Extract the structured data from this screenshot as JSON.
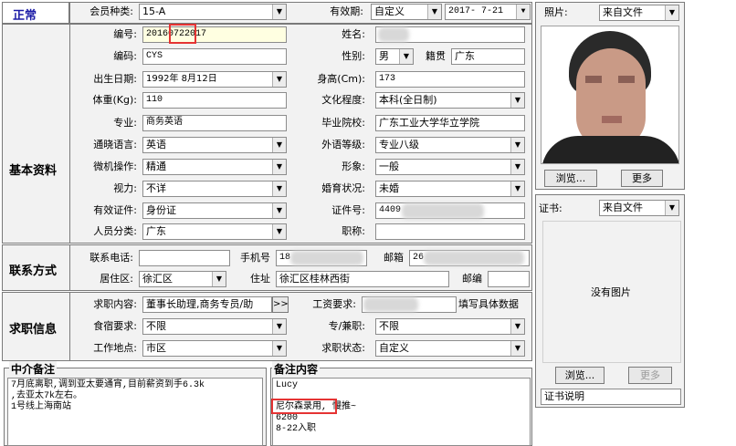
{
  "status_label": "正常",
  "section_basic": "基本资料",
  "section_contact": "联系方式",
  "section_job": "求职信息",
  "fields": {
    "member_type": {
      "label": "会员种类:",
      "value": "15-A"
    },
    "validity": {
      "label": "有效期:",
      "value": "自定义"
    },
    "validity_date": "2017- 7-21",
    "number": {
      "label": "编号:",
      "value": "20160722017"
    },
    "name": {
      "label": "姓名:",
      "value": ""
    },
    "code": {
      "label": "编码:",
      "value": "CYS"
    },
    "gender": {
      "label": "性别:",
      "value": "男"
    },
    "native": {
      "label": "籍贯",
      "value": "广东"
    },
    "birth": {
      "label": "出生日期:",
      "value": "1992年 8月12日"
    },
    "height": {
      "label": "身高(Cm):",
      "value": "173"
    },
    "weight": {
      "label": "体重(Kg):",
      "value": "110"
    },
    "education": {
      "label": "文化程度:",
      "value": "本科(全日制)"
    },
    "major": {
      "label": "专业:",
      "value": "商务英语"
    },
    "school": {
      "label": "毕业院校:",
      "value": "广东工业大学华立学院"
    },
    "language": {
      "label": "通晓语言:",
      "value": "英语"
    },
    "lang_level": {
      "label": "外语等级:",
      "value": "专业八级"
    },
    "computer": {
      "label": "微机操作:",
      "value": "精通"
    },
    "image": {
      "label": "形象:",
      "value": "一般"
    },
    "vision": {
      "label": "视力:",
      "value": "不详"
    },
    "marital": {
      "label": "婚育状况:",
      "value": "未婚"
    },
    "id_type": {
      "label": "有效证件:",
      "value": "身份证"
    },
    "id_no": {
      "label": "证件号:",
      "value": "4409"
    },
    "category": {
      "label": "人员分类:",
      "value": "广东"
    },
    "title": {
      "label": "职称:",
      "value": ""
    }
  },
  "contact": {
    "phone_label": "联系电话:",
    "phone_value": "",
    "mobile_label": "手机号",
    "mobile_value": "18",
    "email_label": "邮箱",
    "email_value": "26",
    "district_label": "居住区:",
    "district_value": "徐汇区",
    "address_label": "住址",
    "address_value": "徐汇区桂林西街",
    "zip_label": "邮编",
    "zip_value": ""
  },
  "job": {
    "content_label": "求职内容:",
    "content_value": "董事长助理,商务专员/助",
    "content_btn": ">>",
    "salary_label": "工资要求:",
    "salary_value": "",
    "salary_hint": "填写具体数据",
    "food_label": "食宿要求:",
    "food_value": "不限",
    "parttime_label": "专/兼职:",
    "parttime_value": "不限",
    "location_label": "工作地点:",
    "location_value": "市区",
    "status_label": "求职状态:",
    "status_value": "自定义"
  },
  "photo": {
    "label": "照片:",
    "source": "来自文件",
    "browse": "浏览...",
    "more": "更多"
  },
  "cert": {
    "label": "证书:",
    "source": "来自文件",
    "empty": "没有图片",
    "browse": "浏览...",
    "more": "更多",
    "desc": "证书说明"
  },
  "agency_note": {
    "title": "中介备注",
    "text": "7月底离职,调到亚太要通宵,目前薪资到手6.3k\n,去亚太7k左右。\n1号线上海南站"
  },
  "remark": {
    "title": "备注内容",
    "text": "Lucy\n\n尼尔森录用, 慢推~\n6200\n8-22入职"
  }
}
